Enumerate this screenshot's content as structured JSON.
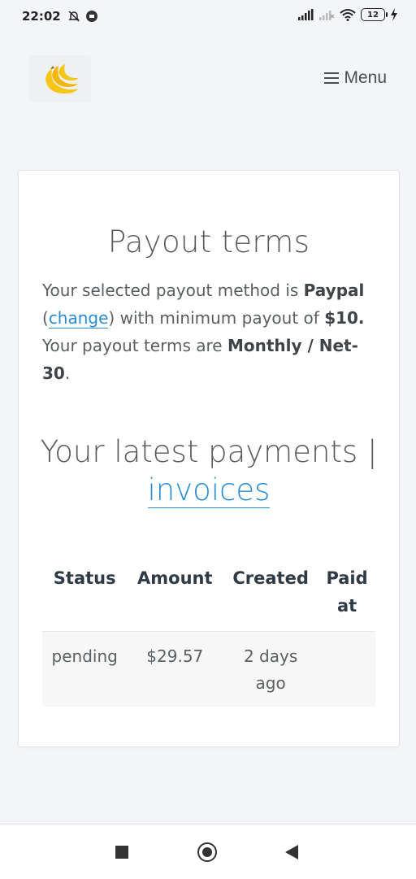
{
  "status_bar": {
    "time": "22:02",
    "battery": "12",
    "icons": [
      "bell-off-icon",
      "shield-icon",
      "signal-icon",
      "signal-weak-icon",
      "wifi-icon",
      "battery-icon",
      "charging-icon"
    ]
  },
  "header": {
    "logo_icon": "banana-logo-icon",
    "menu_icon": "hamburger-icon",
    "menu_label": "Menu"
  },
  "payout": {
    "title": "Payout terms",
    "text_1": "Your selected payout method is",
    "method": "Paypal",
    "paren_open": "(",
    "change_link": "change",
    "text_2": ") with minimum payout of",
    "minimum": "$10.",
    "text_3": "Your payout terms are",
    "terms": "Monthly / Net-30",
    "period": "."
  },
  "payments": {
    "title_prefix": "Your latest payments |",
    "invoices_link": "invoices",
    "columns": [
      "Status",
      "Amount",
      "Created",
      "Paid at"
    ],
    "rows": [
      {
        "status": "pending",
        "amount": "$29.57",
        "created": "2 days ago",
        "paid_at": ""
      }
    ]
  },
  "colors": {
    "accent": "#2a8ccf",
    "logo": "#f5c518",
    "background": "#f3f5f8"
  }
}
